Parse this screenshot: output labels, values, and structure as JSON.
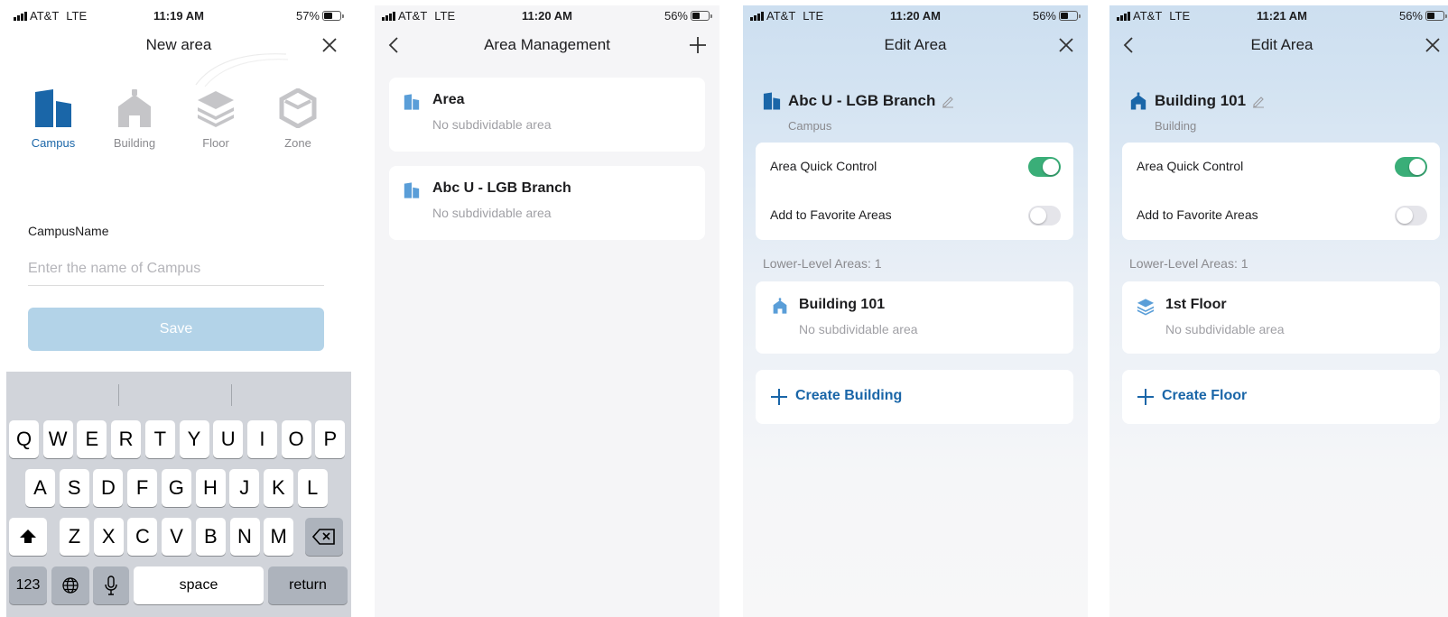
{
  "screens": [
    {
      "status": {
        "carrier": "AT&T",
        "network": "LTE",
        "time": "11:19 AM",
        "battery": "57%",
        "battery_level": 0.57
      },
      "nav": {
        "title": "New area",
        "right_icon": "close-icon"
      },
      "area_types": [
        {
          "label": "Campus",
          "icon": "campus-icon",
          "active": true
        },
        {
          "label": "Building",
          "icon": "building-icon",
          "active": false
        },
        {
          "label": "Floor",
          "icon": "floor-icon",
          "active": false
        },
        {
          "label": "Zone",
          "icon": "zone-icon",
          "active": false
        }
      ],
      "form": {
        "label": "CampusName",
        "placeholder": "Enter the name of Campus",
        "value": "",
        "save_label": "Save"
      },
      "keyboard": {
        "row1": [
          "Q",
          "W",
          "E",
          "R",
          "T",
          "Y",
          "U",
          "I",
          "O",
          "P"
        ],
        "row2": [
          "A",
          "S",
          "D",
          "F",
          "G",
          "H",
          "J",
          "K",
          "L"
        ],
        "row3": [
          "Z",
          "X",
          "C",
          "V",
          "B",
          "N",
          "M"
        ],
        "numbers_label": "123",
        "space_label": "space",
        "return_label": "return"
      }
    },
    {
      "status": {
        "carrier": "AT&T",
        "network": "LTE",
        "time": "11:20 AM",
        "battery": "56%",
        "battery_level": 0.56
      },
      "nav": {
        "title": "Area Management",
        "left_icon": "back-chevron-icon",
        "right_icon": "plus-icon"
      },
      "areas": [
        {
          "name": "Area",
          "subtitle": "No subdividable area",
          "icon": "campus-icon"
        },
        {
          "name": "Abc U - LGB Branch",
          "subtitle": "No subdividable area",
          "icon": "campus-icon"
        }
      ]
    },
    {
      "status": {
        "carrier": "AT&T",
        "network": "LTE",
        "time": "11:20 AM",
        "battery": "56%",
        "battery_level": 0.56
      },
      "nav": {
        "title": "Edit Area",
        "right_icon": "close-icon"
      },
      "header": {
        "name": "Abc U - LGB Branch",
        "type": "Campus",
        "icon": "campus-icon"
      },
      "settings": [
        {
          "label": "Area Quick Control",
          "on": true
        },
        {
          "label": "Add to Favorite Areas",
          "on": false
        }
      ],
      "lower_level_label": "Lower-Level Areas: 1",
      "child": {
        "name": "Building 101",
        "subtitle": "No subdividable area",
        "icon": "building-icon"
      },
      "create_label": "Create Building",
      "accent": "#1a66a8",
      "toggle_on_color": "#3aae78"
    },
    {
      "status": {
        "carrier": "AT&T",
        "network": "LTE",
        "time": "11:21 AM",
        "battery": "56%",
        "battery_level": 0.56
      },
      "nav": {
        "title": "Edit Area",
        "left_icon": "back-chevron-icon",
        "right_icon": "close-icon"
      },
      "header": {
        "name": "Building 101",
        "type": "Building",
        "icon": "building-icon"
      },
      "settings": [
        {
          "label": "Area Quick Control",
          "on": true
        },
        {
          "label": "Add to Favorite Areas",
          "on": false
        }
      ],
      "lower_level_label": "Lower-Level Areas: 1",
      "child": {
        "name": "1st Floor",
        "subtitle": "No subdividable area",
        "icon": "floor-icon"
      },
      "create_label": "Create Floor"
    }
  ]
}
